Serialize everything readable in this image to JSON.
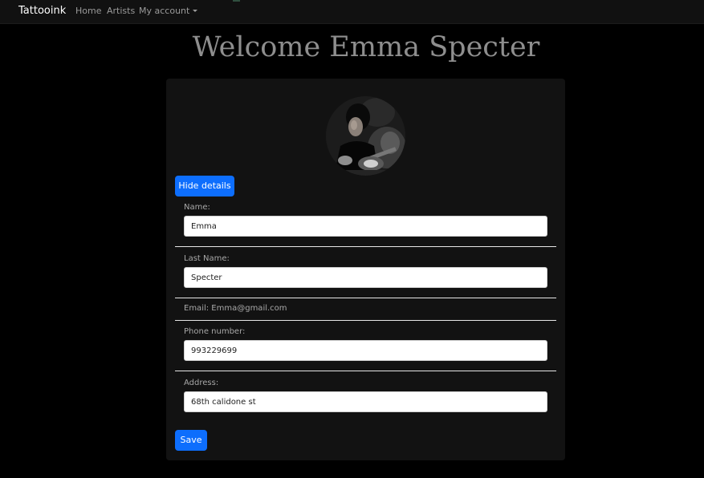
{
  "navbar": {
    "brand": "Tattooink",
    "links": [
      "Home",
      "Artists"
    ],
    "account_label": "My account",
    "account_icon": "caret-down-icon"
  },
  "welcome": "Welcome Emma Specter",
  "profile": {
    "avatar": "profile-photo",
    "toggle_label": "Hide details",
    "fields": {
      "name": {
        "label": "Name:",
        "value": "Emma"
      },
      "last_name": {
        "label": "Last Name:",
        "value": "Specter"
      },
      "email": "Email: Emma@gmail.com",
      "phone": {
        "label": "Phone number:",
        "value": "993229699"
      },
      "address": {
        "label": "Address:",
        "value": "68th calidone st"
      }
    },
    "save_label": "Save"
  },
  "colors": {
    "page_bg": "#000000",
    "navbar_bg": "#111111",
    "card_bg": "#121212",
    "button": "#0d6efd",
    "heading": "#8e8e8e"
  }
}
